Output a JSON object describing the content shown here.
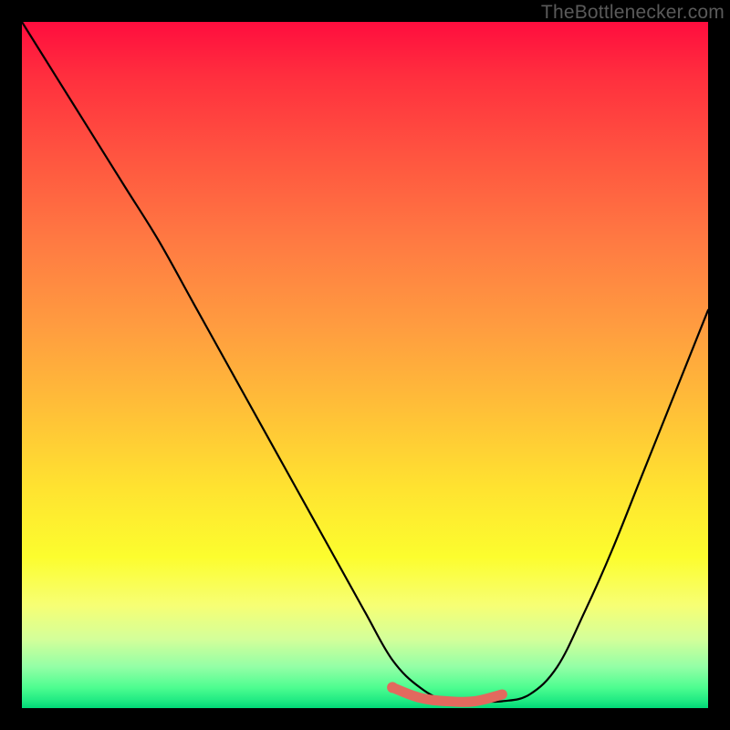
{
  "watermark": "TheBottlenecker.com",
  "chart_data": {
    "type": "line",
    "title": "",
    "xlabel": "",
    "ylabel": "",
    "xlim": [
      0,
      100
    ],
    "ylim": [
      0,
      100
    ],
    "background_gradient": {
      "top_color": "#ff0d3e",
      "bottom_color": "#00d977",
      "meaning": "red = high bottleneck, green = low bottleneck"
    },
    "series": [
      {
        "name": "bottleneck-curve",
        "color": "#000000",
        "x": [
          0,
          5,
          10,
          15,
          20,
          25,
          30,
          35,
          40,
          45,
          50,
          54,
          58,
          62,
          66,
          70,
          74,
          78,
          82,
          86,
          90,
          94,
          98,
          100
        ],
        "y": [
          100,
          92,
          84,
          76,
          68,
          59,
          50,
          41,
          32,
          23,
          14,
          7,
          3,
          1,
          1,
          1,
          2,
          6,
          14,
          23,
          33,
          43,
          53,
          58
        ]
      },
      {
        "name": "optimal-range-marker",
        "color": "#e2695e",
        "x": [
          54,
          58,
          62,
          66,
          70
        ],
        "y": [
          3,
          1.5,
          1,
          1,
          2
        ]
      }
    ],
    "optimal_range": {
      "x_start": 54,
      "x_end": 70
    }
  }
}
